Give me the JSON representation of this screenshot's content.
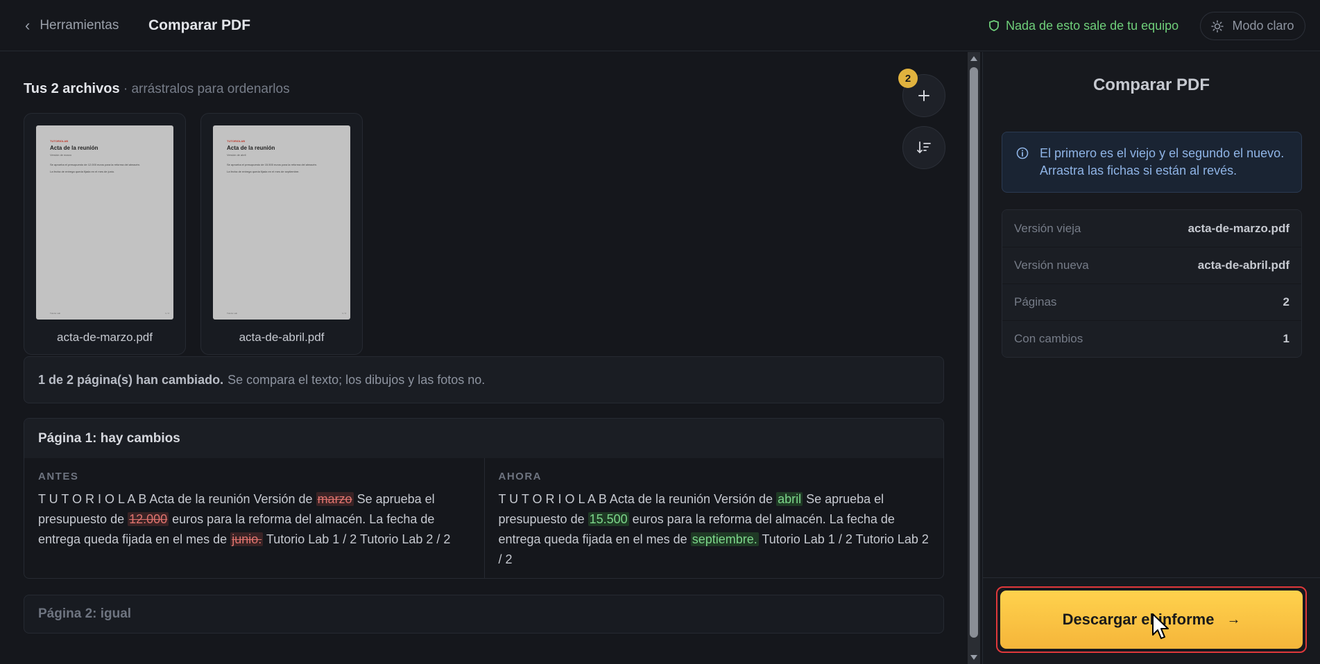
{
  "topbar": {
    "back_label": "Herramientas",
    "title": "Comparar PDF",
    "privacy_text": "Nada de esto sale de tu equipo",
    "mode_label": "Modo claro"
  },
  "files": {
    "heading": "Tus 2 archivos",
    "hint": " · arrástralos para ordenarlos",
    "count": "2",
    "items": [
      {
        "name": "acta-de-marzo.pdf",
        "preview": {
          "brand": "TUTORIOLAB",
          "title": "Acta de la reunión",
          "subtitle": "Versión de marzo",
          "line1": "Se aprueba el presupuesto de 12.000 euros para la reforma del almacén.",
          "line2": "La fecha de entrega queda fijada en el mes de junio.",
          "footer_left": "Tutorio Lab",
          "footer_right": "1 / 2"
        }
      },
      {
        "name": "acta-de-abril.pdf",
        "preview": {
          "brand": "TUTORIOLAB",
          "title": "Acta de la reunión",
          "subtitle": "Versión de abril",
          "line1": "Se aprueba el presupuesto de 15.500 euros para la reforma del almacén.",
          "line2": "La fecha de entrega queda fijada en el mes de septiembre.",
          "footer_left": "Tutorio Lab",
          "footer_right": "1 / 2"
        }
      }
    ]
  },
  "summary": {
    "bold": "1 de 2 página(s) han cambiado.",
    "rest": "Se compara el texto; los dibujos y las fotos no."
  },
  "page1": {
    "title": "Página 1: hay cambios",
    "before_label": "ANTES",
    "after_label": "AHORA",
    "before": {
      "t1": "T U T O R I O L A B Acta de la reunión Versión de ",
      "d1": "marzo",
      "t2": " Se aprueba el presupuesto de ",
      "d2": "12.000",
      "t3": " euros para la reforma del almacén. La fecha de entrega queda fijada en el mes de ",
      "d3": "junio.",
      "t4": " Tutorio Lab 1 / 2 Tutorio Lab 2 / 2"
    },
    "after": {
      "t1": "T U T O R I O L A B Acta de la reunión Versión de ",
      "i1": "abril",
      "t2": " Se aprueba el presupuesto de ",
      "i2": "15.500",
      "t3": " euros para la reforma del almacén. La fecha de entrega queda fijada en el mes de ",
      "i3": "septiembre.",
      "t4": " Tutorio Lab 1 / 2 Tutorio Lab 2 / 2"
    }
  },
  "page2": {
    "title": "Página 2: igual"
  },
  "side": {
    "title": "Comparar PDF",
    "info": "El primero es el viejo y el segundo el nuevo. Arrastra las fichas si están al revés.",
    "props": [
      {
        "key": "Versión vieja",
        "value": "acta-de-marzo.pdf"
      },
      {
        "key": "Versión nueva",
        "value": "acta-de-abril.pdf"
      },
      {
        "key": "Páginas",
        "value": "2"
      },
      {
        "key": "Con cambios",
        "value": "1"
      }
    ],
    "download_label": "Descargar el informe",
    "download_arrow": "→"
  },
  "colors": {
    "accent": "#f5b53a",
    "deleted": "#e0736e",
    "inserted": "#7cd68a",
    "privacy": "#6fcf7a",
    "highlight_outline": "#e0383b"
  },
  "icons": {
    "back": "chevron-left-icon",
    "privacy": "shield-icon",
    "mode": "sun-icon",
    "add": "plus-icon",
    "sort": "sort-icon",
    "info": "info-icon",
    "download": "arrow-right-icon"
  }
}
